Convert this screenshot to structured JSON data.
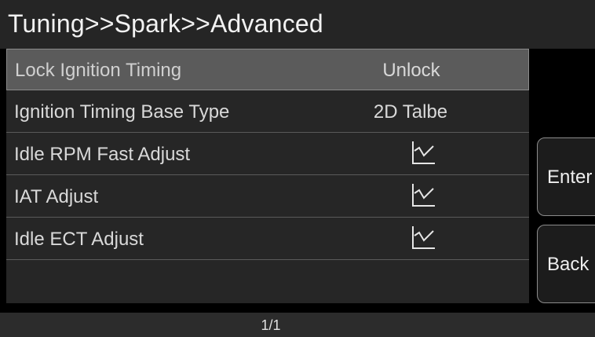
{
  "header": {
    "breadcrumb": "Tuning>>Spark>>Advanced"
  },
  "list": {
    "rows": [
      {
        "label": "Lock Ignition Timing",
        "value": "Unlock",
        "selected": true
      },
      {
        "label": "Ignition Timing Base Type",
        "value": "2D Talbe"
      },
      {
        "label": "Idle RPM Fast Adjust",
        "icon": "line-chart-icon"
      },
      {
        "label": "IAT Adjust",
        "icon": "line-chart-icon"
      },
      {
        "label": "Idle ECT Adjust",
        "icon": "line-chart-icon"
      }
    ]
  },
  "side_buttons": {
    "enter_label": "Enter",
    "back_label": "Back"
  },
  "footer": {
    "page_indicator": "1/1"
  },
  "colors": {
    "background": "#000000",
    "panel": "#262626",
    "selected_row": "#5b5b5b",
    "text": "#d9d9d9"
  }
}
